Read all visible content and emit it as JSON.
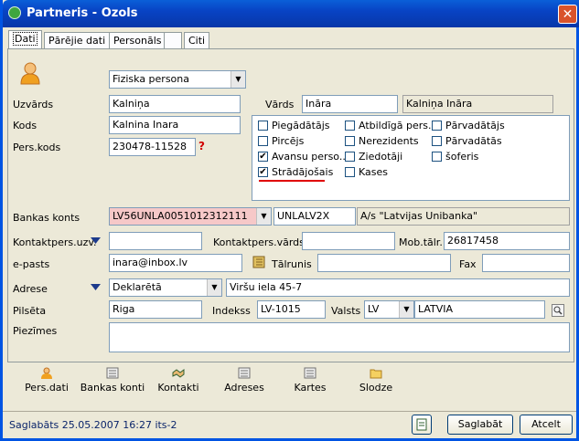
{
  "window": {
    "title": "Partneris - Ozols",
    "close_glyph": "✕"
  },
  "tabs": [
    {
      "label": "Dati"
    },
    {
      "label": "Pārējie dati"
    },
    {
      "label": "Personāls"
    },
    {
      "label": ""
    },
    {
      "label": "Citi"
    }
  ],
  "form": {
    "type_value": "Fiziska persona",
    "uzvards": {
      "label": "Uzvārds",
      "value": "Kalniņa"
    },
    "vards": {
      "label": "Vārds",
      "value": "Ināra",
      "full": "Kalniņa Ināra"
    },
    "kods": {
      "label": "Kods",
      "value": "Kalnina Inara"
    },
    "pers_kods": {
      "label": "Pers.kods",
      "value": "230478-11528",
      "marker": "?"
    },
    "roles": [
      {
        "label": "Piegādātājs",
        "checked": false
      },
      {
        "label": "Atbildīgā pers...",
        "checked": false
      },
      {
        "label": "Pārvadātājs",
        "checked": false
      },
      {
        "label": "Pircējs",
        "checked": false
      },
      {
        "label": "Nerezidents",
        "checked": false
      },
      {
        "label": "Pārvadātās",
        "checked": false
      },
      {
        "label": "Avansu perso...",
        "checked": true
      },
      {
        "label": "Ziedotāji",
        "checked": false
      },
      {
        "label": "šoferis",
        "checked": false
      },
      {
        "label": "Strādājošais",
        "checked": true
      },
      {
        "label": "Kases",
        "checked": false
      }
    ],
    "bank": {
      "label": "Bankas konts",
      "account": "LV56UNLA0051012312111",
      "swift": "UNLALV2X",
      "bank_name": "A/s \"Latvijas Unibanka\""
    },
    "kontakt_uzv": {
      "label": "Kontaktpers.uzv.",
      "value": ""
    },
    "kontakt_vards": {
      "label": "Kontaktpers.vārds",
      "value": ""
    },
    "mob": {
      "label": "Mob.tālr.",
      "value": "26817458"
    },
    "email": {
      "label": "e-pasts",
      "value": "inara@inbox.lv"
    },
    "talrunis": {
      "label": "Tālrunis",
      "value": ""
    },
    "fax": {
      "label": "Fax",
      "value": ""
    },
    "adrese": {
      "label": "Adrese",
      "type": "Deklarētā",
      "value": "Viršu iela 45-7"
    },
    "pilseta": {
      "label": "Pilsēta",
      "value": "Riga"
    },
    "indekss": {
      "label": "Indekss",
      "value": "LV-1015"
    },
    "valsts": {
      "label": "Valsts",
      "code": "LV",
      "name": "LATVIA"
    },
    "piezimes": {
      "label": "Piezīmes",
      "value": ""
    }
  },
  "toolbar": [
    {
      "label": "Pers.dati",
      "icon": "person-icon"
    },
    {
      "label": "Bankas konti",
      "icon": "list-icon"
    },
    {
      "label": "Kontakti",
      "icon": "handshake-icon"
    },
    {
      "label": "Adreses",
      "icon": "list-icon"
    },
    {
      "label": "Kartes",
      "icon": "list-icon"
    },
    {
      "label": "Slodze",
      "icon": "folder-icon"
    }
  ],
  "status": "Saglabāts 25.05.2007 16:27 its-2",
  "buttons": {
    "save": "Saglabāt",
    "cancel": "Atcelt"
  },
  "colors": {
    "title_bg": "#0843c4",
    "required_underline": "#e00000",
    "status_text": "#0a246a",
    "highlight_field": "#f6c8c8"
  }
}
